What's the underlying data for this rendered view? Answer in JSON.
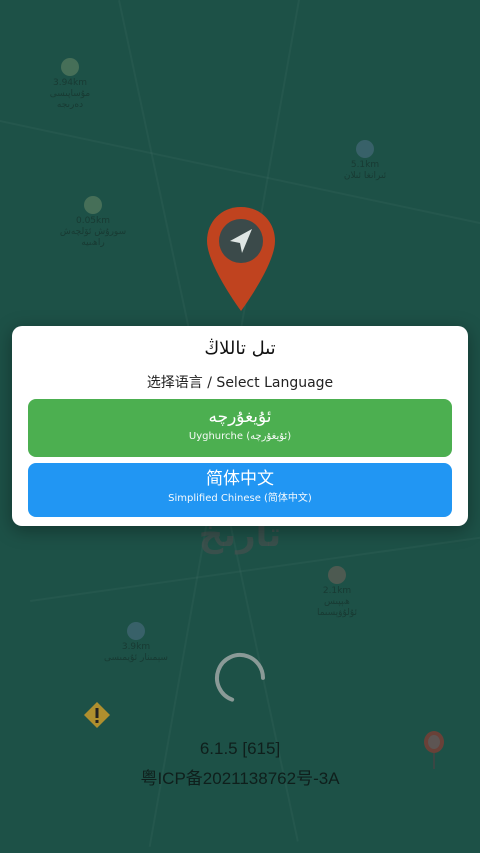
{
  "background": {
    "map_labels": [
      {
        "name": "3.94km",
        "sub": "ﻣﯘﺳﺎﭘﯩﺴﻰ ﺩﻩﺭﯨﺠﻪ"
      },
      {
        "name": "5.1km",
        "sub": "ﺋﯩﺮﺍﻧﻐﺎ ﺋﯩﻼﻥ"
      },
      {
        "name": "0.05km",
        "sub": "ﺳﻮﺭﯗﺵ ﺋﯚﻟﭽﻪﺵ ﺭﺍﮪﯩﻴﻪ"
      },
      {
        "name": "2.1km",
        "sub": "ﮪﯧﭙﯩﺲ ﺋﯘﻟﯘﯞﯦﺴﯩﻤﺎ"
      },
      {
        "name": "3.9km",
        "sub": "ﺳﯧﻤﯩﻨﺎﺭ ﺋﯘﻳﻤﯩﺴﻰ"
      }
    ],
    "brand_word": "ﺗﺎﺭﯨﺦ"
  },
  "dialog": {
    "title": "تىل تاللاڭ",
    "subtitle": "选择语言 / Select Language",
    "options": [
      {
        "label": "ئۇيغۇرچە",
        "sublabel": "Uyghurche (ئۇيغۇرچە)",
        "color": "#4caf50"
      },
      {
        "label": "简体中文",
        "sublabel": "Simplified Chinese (简体中文)",
        "color": "#2196f3"
      }
    ]
  },
  "footer": {
    "version": "6.1.5 [615]",
    "icp": "粤ICP备2021138762号-3A"
  },
  "colors": {
    "background": "#1d5147",
    "pin": "#c0431f"
  }
}
